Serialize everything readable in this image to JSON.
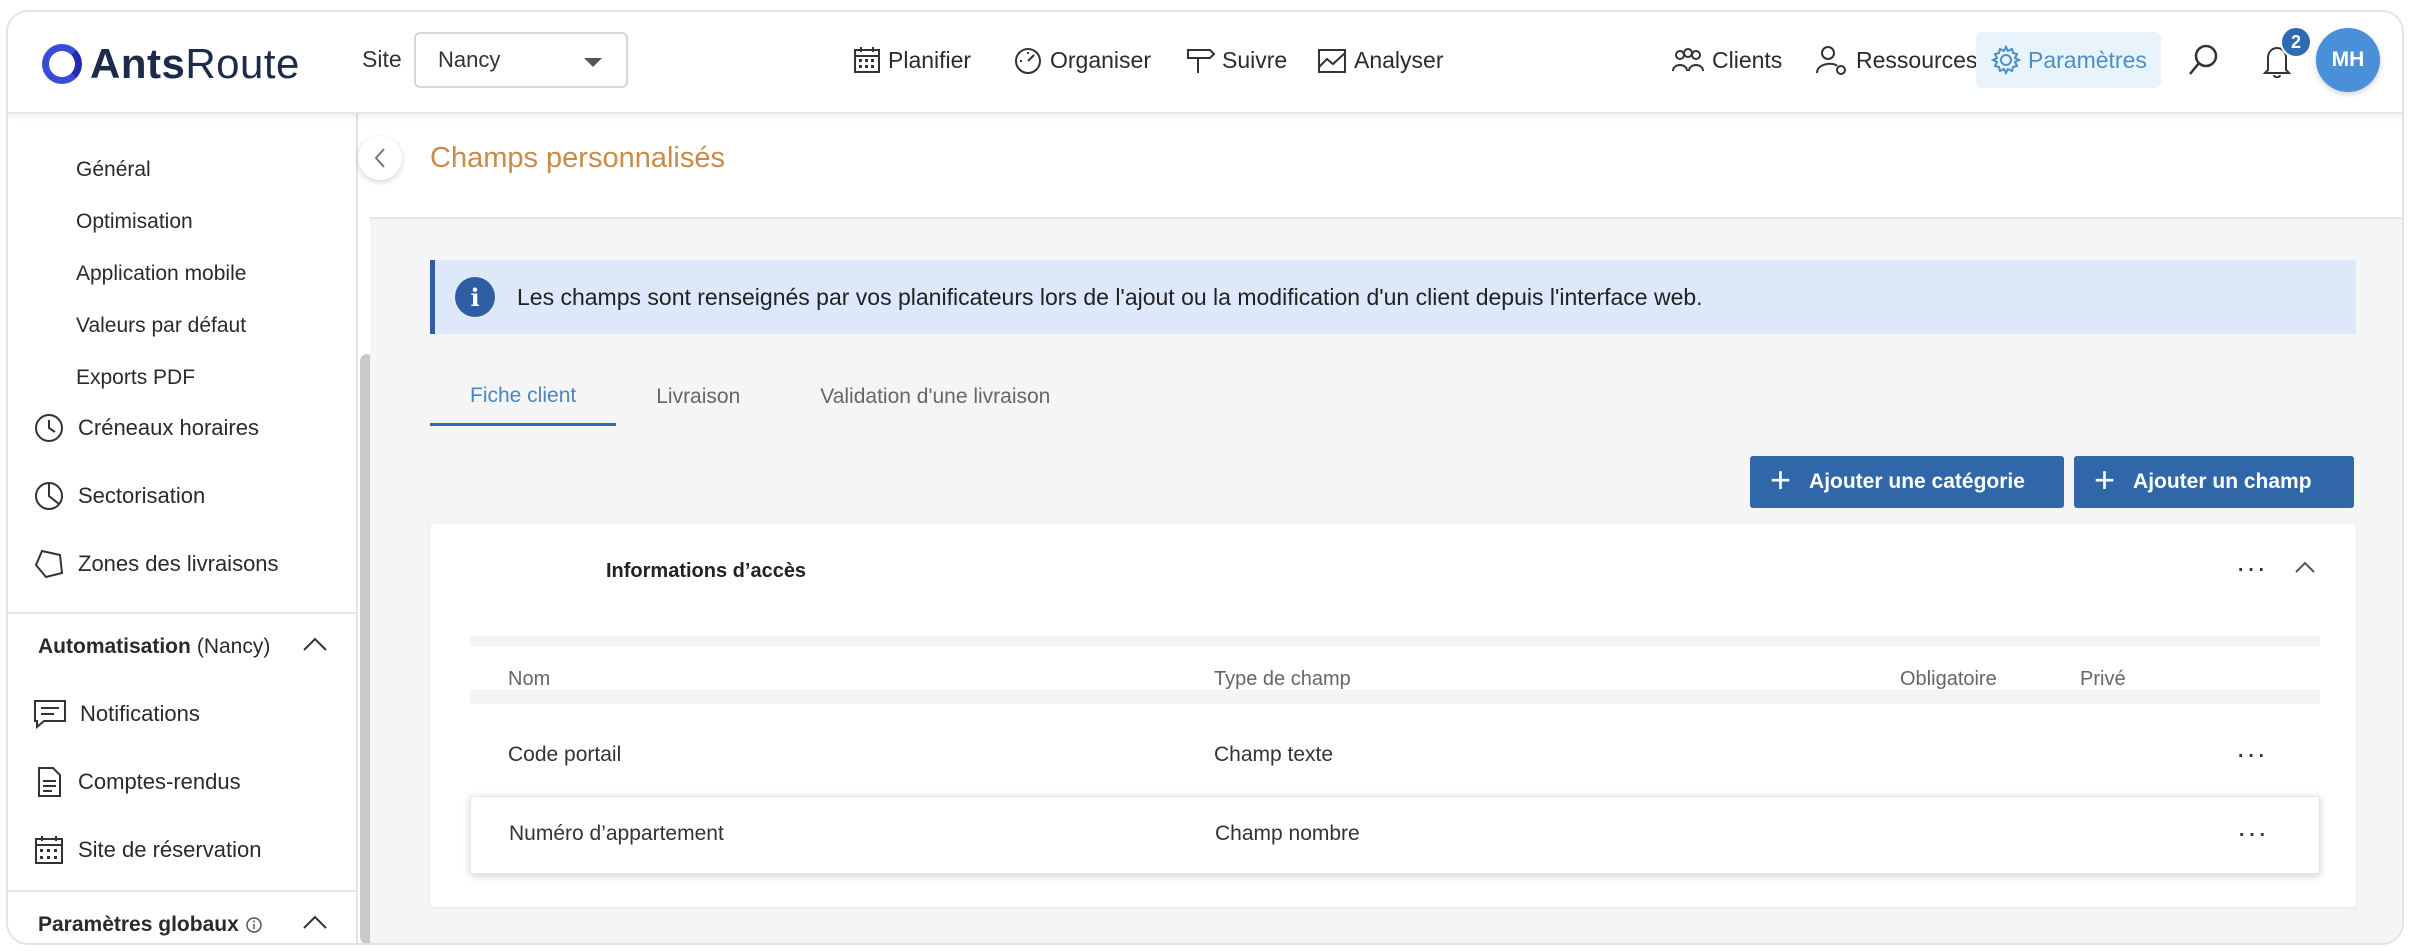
{
  "app": {
    "logo_bold": "Ants",
    "logo_light": "Route"
  },
  "header": {
    "site_label": "Site",
    "site_value": "Nancy",
    "nav": {
      "planifier": "Planifier",
      "organiser": "Organiser",
      "suivre": "Suivre",
      "analyser": "Analyser",
      "clients": "Clients",
      "ressources": "Ressources",
      "parametres": "Paramètres"
    },
    "notifications_count": "2",
    "avatar_initials": "MH"
  },
  "sidebar": {
    "sub_items": [
      "Général",
      "Optimisation",
      "Application mobile",
      "Valeurs par défaut",
      "Exports PDF"
    ],
    "items": {
      "creneaux": "Créneaux horaires",
      "sectorisation": "Sectorisation",
      "zones": "Zones des livraisons",
      "notifications": "Notifications",
      "comptes_rendus": "Comptes-rendus",
      "site_reservation": "Site de réservation"
    },
    "section_automatisation": {
      "label": "Automatisation",
      "site": "(Nancy)"
    },
    "section_globaux": {
      "label": "Paramètres globaux"
    }
  },
  "main": {
    "title": "Champs personnalisés",
    "info": "Les champs sont renseignés par vos planificateurs lors de l'ajout ou la modification d'un client depuis l'interface web.",
    "tabs": [
      "Fiche client",
      "Livraison",
      "Validation d'une livraison"
    ],
    "buttons": {
      "add_category": "Ajouter une catégorie",
      "add_field": "Ajouter un champ"
    },
    "panel": {
      "title": "Informations d’accès",
      "columns": {
        "nom": "Nom",
        "type": "Type de champ",
        "obligatoire": "Obligatoire",
        "prive": "Privé"
      },
      "rows": [
        {
          "nom": "Code portail",
          "type": "Champ texte"
        },
        {
          "nom": "Numéro d’appartement",
          "type": "Champ nombre"
        }
      ]
    }
  },
  "colors": {
    "accent": "#2f67a8",
    "title": "#c98b4a",
    "banner": "#dde8fb",
    "active_nav": "#4a8fc9"
  }
}
